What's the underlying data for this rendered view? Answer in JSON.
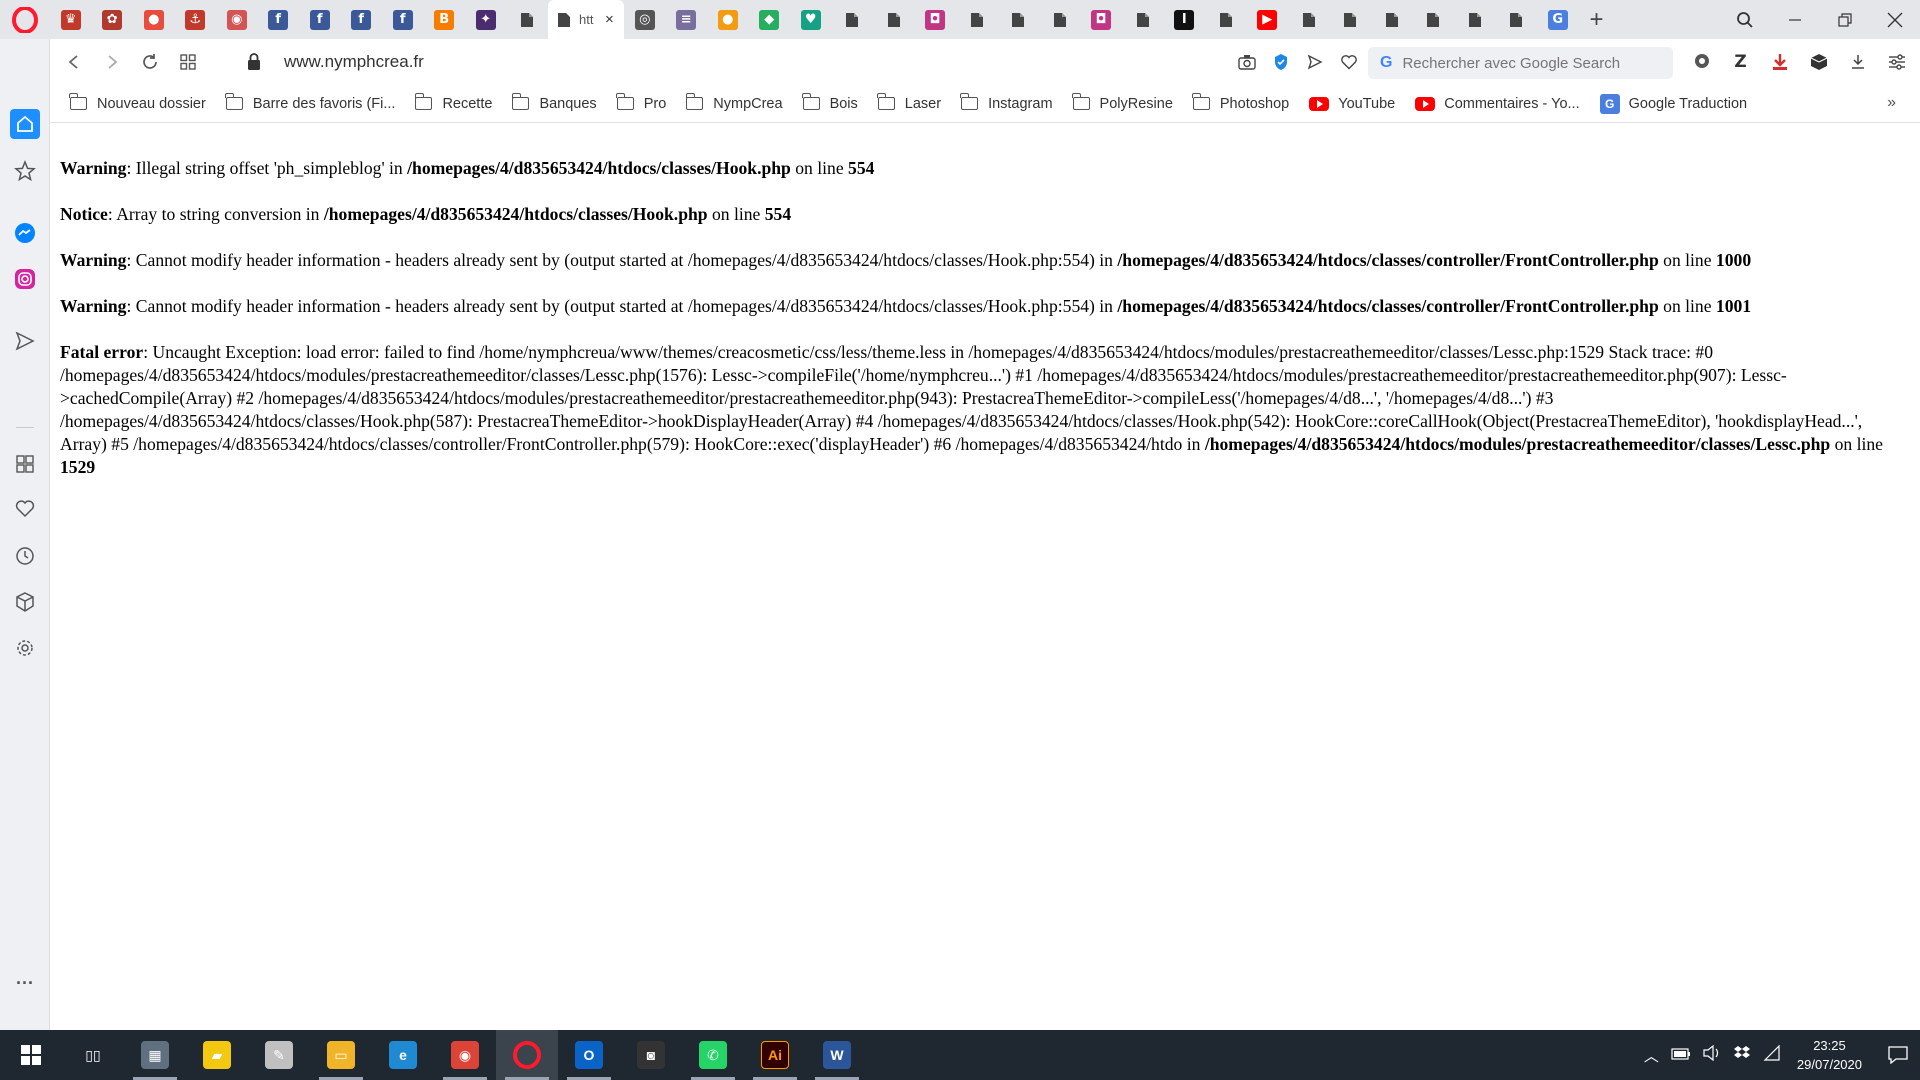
{
  "tabbar": {
    "active_tab": {
      "label": "htt",
      "close_label": "×",
      "icon": "page-icon"
    },
    "pinned_tabs": [
      {
        "icon": "mask-icon",
        "color": "#c0392b",
        "glyph": "♛"
      },
      {
        "icon": "flower-icon",
        "color": "#b03a2e",
        "glyph": "✿"
      },
      {
        "icon": "strawberry-icon",
        "color": "#e74c3c",
        "glyph": "●"
      },
      {
        "icon": "anchor-icon",
        "color": "#c0392b",
        "glyph": "⚓"
      },
      {
        "icon": "shop-icon",
        "color": "#d35454",
        "glyph": "◉"
      },
      {
        "icon": "facebook-icon",
        "color": "#3b5998",
        "glyph": "f"
      },
      {
        "icon": "facebook-icon",
        "color": "#3b5998",
        "glyph": "f"
      },
      {
        "icon": "facebook-icon",
        "color": "#3b5998",
        "glyph": "f"
      },
      {
        "icon": "facebook-icon",
        "color": "#3b5998",
        "glyph": "f"
      },
      {
        "icon": "blogger-icon",
        "color": "#f57d00",
        "glyph": "B"
      },
      {
        "icon": "bird-icon",
        "color": "#4b2c6e",
        "glyph": "✦"
      },
      {
        "icon": "page-icon",
        "color": "page",
        "glyph": "▬"
      }
    ],
    "pinned_tabs_after": [
      {
        "icon": "eye-icon",
        "color": "#555555",
        "glyph": "◎"
      },
      {
        "icon": "lines-icon",
        "color": "#7a6e9c",
        "glyph": "≡"
      },
      {
        "icon": "orange-icon",
        "color": "#f39c12",
        "glyph": "●"
      },
      {
        "icon": "book-icon",
        "color": "#27ae60",
        "glyph": "◆"
      },
      {
        "icon": "heart-icon",
        "color": "#16a085",
        "glyph": "♥"
      },
      {
        "icon": "page-icon",
        "color": "page",
        "glyph": "▬"
      },
      {
        "icon": "page-icon",
        "color": "page",
        "glyph": "▬"
      },
      {
        "icon": "instagram-icon",
        "color": "#c13584",
        "glyph": "◘"
      },
      {
        "icon": "page-icon",
        "color": "page",
        "glyph": "▬"
      },
      {
        "icon": "page-icon",
        "color": "page",
        "glyph": "▬"
      },
      {
        "icon": "page-icon",
        "color": "page",
        "glyph": "▬"
      },
      {
        "icon": "instagram-icon",
        "color": "#c13584",
        "glyph": "◘"
      },
      {
        "icon": "page-icon",
        "color": "page",
        "glyph": "▬"
      },
      {
        "icon": "letter-i-icon",
        "color": "#111111",
        "glyph": "I"
      },
      {
        "icon": "page-icon",
        "color": "page",
        "glyph": "▬"
      },
      {
        "icon": "youtube-icon",
        "color": "#ff0000",
        "glyph": "▶"
      },
      {
        "icon": "page-icon",
        "color": "page",
        "glyph": "▬"
      },
      {
        "icon": "page-icon",
        "color": "page",
        "glyph": "▬"
      },
      {
        "icon": "page-icon",
        "color": "page",
        "glyph": "▬"
      },
      {
        "icon": "page-icon",
        "color": "page",
        "glyph": "▬"
      },
      {
        "icon": "page-icon",
        "color": "page",
        "glyph": "▬"
      },
      {
        "icon": "page-icon",
        "color": "page",
        "glyph": "▬"
      },
      {
        "icon": "translate-icon",
        "color": "#4a7fe0",
        "glyph": "G"
      }
    ],
    "new_tab_label": "+"
  },
  "address": {
    "url": "www.nymphcrea.fr",
    "search_placeholder": "Rechercher avec Google Search"
  },
  "bookmarks": [
    {
      "label": "Nouveau dossier",
      "type": "folder"
    },
    {
      "label": "Barre des favoris (Fi...",
      "type": "folder"
    },
    {
      "label": "Recette",
      "type": "folder"
    },
    {
      "label": "Banques",
      "type": "folder"
    },
    {
      "label": "Pro",
      "type": "folder"
    },
    {
      "label": "NympCrea",
      "type": "folder"
    },
    {
      "label": "Bois",
      "type": "folder"
    },
    {
      "label": "Laser",
      "type": "folder"
    },
    {
      "label": "Instagram",
      "type": "folder"
    },
    {
      "label": "PolyResine",
      "type": "folder"
    },
    {
      "label": "Photoshop",
      "type": "folder"
    },
    {
      "label": "YouTube",
      "type": "youtube"
    },
    {
      "label": "Commentaires - Yo...",
      "type": "youtube"
    },
    {
      "label": "Google Traduction",
      "type": "translate"
    }
  ],
  "errors": {
    "e1": {
      "level": "Warning",
      "text": ": Illegal string offset 'ph_simpleblog' in ",
      "file": "/homepages/4/d835653424/htdocs/classes/Hook.php",
      "online": " on line ",
      "line": "554"
    },
    "e2": {
      "level": "Notice",
      "text": ": Array to string conversion in ",
      "file": "/homepages/4/d835653424/htdocs/classes/Hook.php",
      "online": " on line ",
      "line": "554"
    },
    "e3": {
      "level": "Warning",
      "text": ": Cannot modify header information - headers already sent by (output started at /homepages/4/d835653424/htdocs/classes/Hook.php:554) in ",
      "file": "/homepages/4/d835653424/htdocs/classes/controller/FrontController.php",
      "online": " on line ",
      "line": "1000"
    },
    "e4": {
      "level": "Warning",
      "text": ": Cannot modify header information - headers already sent by (output started at /homepages/4/d835653424/htdocs/classes/Hook.php:554) in ",
      "file": "/homepages/4/d835653424/htdocs/classes/controller/FrontController.php",
      "online": " on line ",
      "line": "1001"
    },
    "e5": {
      "level": "Fatal error",
      "text": ": Uncaught Exception: load error: failed to find /home/nymphcreua/www/themes/creacosmetic/css/less/theme.less in /homepages/4/d835653424/htdocs/modules/prestacreathemeeditor/classes/Lessc.php:1529 Stack trace: #0 /homepages/4/d835653424/htdocs/modules/prestacreathemeeditor/classes/Lessc.php(1576): Lessc->compileFile('/home/nymphcreu...') #1 /homepages/4/d835653424/htdocs/modules/prestacreathemeeditor/prestacreathemeeditor.php(907): Lessc->cachedCompile(Array) #2 /homepages/4/d835653424/htdocs/modules/prestacreathemeeditor/prestacreathemeeditor.php(943): PrestacreaThemeEditor->compileLess('/homepages/4/d8...', '/homepages/4/d8...') #3 /homepages/4/d835653424/htdocs/classes/Hook.php(587): PrestacreaThemeEditor->hookDisplayHeader(Array) #4 /homepages/4/d835653424/htdocs/classes/Hook.php(542): HookCore::coreCallHook(Object(PrestacreaThemeEditor), 'hookdisplayHead...', Array) #5 /homepages/4/d835653424/htdocs/classes/controller/FrontController.php(579): HookCore::exec('displayHeader') #6 /homepages/4/d835653424/htdo in ",
      "file": "/homepages/4/d835653424/htdocs/modules/prestacreathemeeditor/classes/Lessc.php",
      "online": " on line ",
      "line": "1529"
    }
  },
  "sidebar_more": "...",
  "taskbar": {
    "apps": [
      {
        "icon": "task-view-icon",
        "color": "transparent",
        "glyph": "▯▯"
      },
      {
        "icon": "calculator-icon",
        "color": "#607080",
        "glyph": "▦"
      },
      {
        "icon": "sticky-notes-icon",
        "color": "#f2c811",
        "glyph": "▰"
      },
      {
        "icon": "paint-icon",
        "color": "#c0c0c0",
        "glyph": "✎"
      },
      {
        "icon": "file-explorer-icon",
        "color": "#f0b429",
        "glyph": "▭"
      },
      {
        "icon": "edge-icon",
        "color": "#1f8ad2",
        "glyph": "e"
      },
      {
        "icon": "chrome-icon",
        "color": "#db4437",
        "glyph": "◉"
      },
      {
        "icon": "opera-icon",
        "color": "#ff1b2d",
        "glyph": "O"
      },
      {
        "icon": "outlook-icon",
        "color": "#0a64c8",
        "glyph": "O"
      },
      {
        "icon": "camera-icon",
        "color": "#333333",
        "glyph": "◙"
      },
      {
        "icon": "whatsapp-icon",
        "color": "#25d366",
        "glyph": "✆"
      },
      {
        "icon": "illustrator-icon",
        "color": "#330000",
        "glyph": "Ai"
      },
      {
        "icon": "word-icon",
        "color": "#2b579a",
        "glyph": "W"
      }
    ],
    "time": "23:25",
    "date": "29/07/2020"
  }
}
